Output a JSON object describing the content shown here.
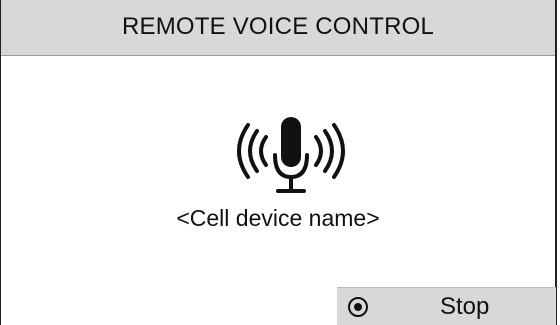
{
  "header": {
    "title": "REMOTE VOICE CONTROL"
  },
  "main": {
    "icon": "microphone-broadcasting-icon",
    "device_name": "<Cell device name>"
  },
  "softkey": {
    "icon": "radio-button-icon",
    "label": "Stop"
  },
  "colors": {
    "header_bg": "#d8d8d8",
    "softkey_bg": "#d8d8d8",
    "text": "#111111",
    "background": "#ffffff"
  }
}
